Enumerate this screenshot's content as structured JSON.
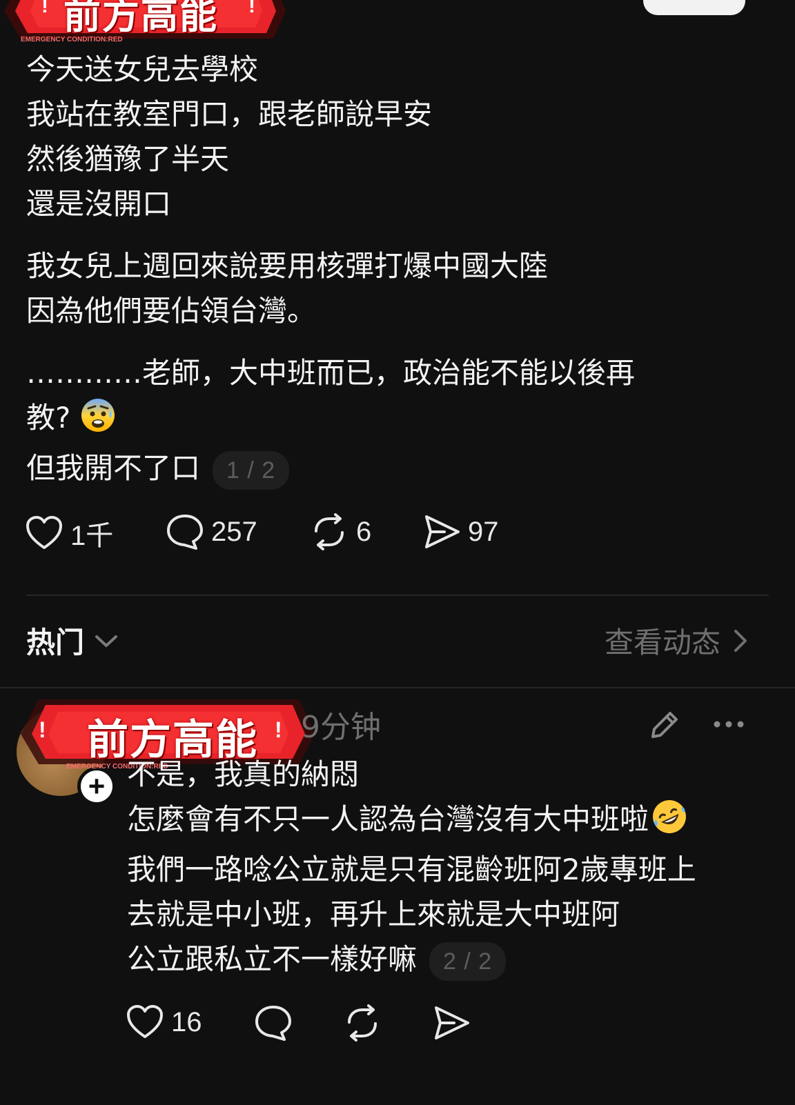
{
  "post": {
    "sticker": {
      "text": "前方高能",
      "sub": "EMERGENCY  CONDITION:RED",
      "bang": "!"
    },
    "paragraph1": [
      "今天送女兒去學校",
      "我站在教室門口，跟老師說早安",
      "然後猶豫了半天",
      "還是沒開口"
    ],
    "paragraph2": [
      "我女兒上週回來說要用核彈打爆中國大陸",
      "因為他們要佔領台灣。"
    ],
    "paragraph3_line1": "…………老師，大中班而已，政治能不能以後再",
    "paragraph3_line2": "教?",
    "paragraph3_line3": "但我開不了口",
    "page_indicator": "1 / 2",
    "actions": {
      "likes": "1千",
      "comments": "257",
      "reposts": "6",
      "shares": "97"
    }
  },
  "sort_bar": {
    "label": "热门",
    "view_activity": "查看动态"
  },
  "comment": {
    "sticker": {
      "text": "前方高能",
      "sub": "EMERGENCY  CONDITION:RED",
      "bang": "!"
    },
    "time": "9分钟",
    "lines": [
      "不是，我真的納悶",
      "怎麼會有不只一人認為台灣沒有大中班啦",
      "我們一路唸公立就是只有混齡班阿2歲專班上",
      "去就是中小班，再升上來就是大中班阿",
      "公立跟私立不一樣好嘛"
    ],
    "page_indicator": "2 / 2",
    "actions": {
      "likes": "16"
    },
    "follow_symbol": "+"
  },
  "colors": {
    "background": "#101010",
    "text": "#f3f3f3",
    "muted": "#6f6f6f",
    "sticker_red": "#e8242a"
  },
  "icons": [
    "heart-icon",
    "comment-bubble-icon",
    "repost-icon",
    "share-send-icon",
    "chevron-down-icon",
    "chevron-right-icon",
    "edit-pencil-icon",
    "more-dots-icon",
    "anxious-face-emoji",
    "rolling-laughing-emoji"
  ]
}
